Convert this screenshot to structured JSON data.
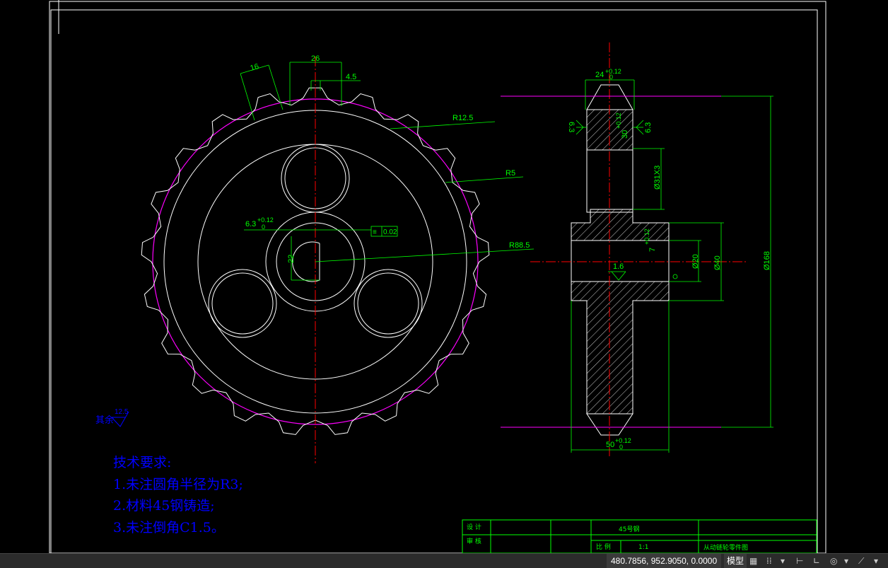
{
  "colors": {
    "background": "#000000",
    "drawing": "#ffffff",
    "dimension": "#00ff00",
    "centerline": "#ff0000",
    "pitch_circle": "#ff00ff",
    "notes": "#0000ff"
  },
  "front_view": {
    "dims": {
      "width_26": "26",
      "width_16": "16",
      "width_4_5": "4.5",
      "r12_5": "R12.5",
      "r5": "R5",
      "r88_5": "R88.5",
      "keyway": "6.3",
      "keyway_tol_upper": "+0.12",
      "keyway_tol_lower": "0",
      "bore_22": "22",
      "symmetry_tol": "0.02"
    }
  },
  "side_view": {
    "dims": {
      "width_24": "24",
      "width_24_tol_upper": "+0.12",
      "width_24_tol_lower": "0",
      "rough_63_left": "6.3",
      "rough_63_right": "6.3",
      "tooth_30": "30",
      "tooth_30_tol": "+0.12",
      "holes_31x3": "Ø31X3",
      "hub_7": "7",
      "hub_7_tol": "+0.12",
      "bore_20": "Ø20",
      "hub_40": "Ø40",
      "outer_168": "Ø168",
      "rough_16": "1.6",
      "width_50": "50",
      "width_50_tol_upper": "+0.12",
      "width_50_tol_lower": "0"
    }
  },
  "other_roughness": {
    "label": "其余",
    "value": "12.5"
  },
  "tech_requirements": {
    "title": "技术要求:",
    "items": [
      "1.未注圆角半径为R3;",
      "2.材料45钢铸造;",
      "3.未注倒角C1.5。"
    ]
  },
  "title_block": {
    "design": "设 计",
    "check": "审 核",
    "material": "45号钢",
    "scale_label": "比 例",
    "scale_value": "1:1",
    "part_name": "从动链轮零件图"
  },
  "status_bar": {
    "coordinates": "480.7856, 952.9050, 0.0000",
    "model_label": "模型",
    "grid_icon": "grid-icon",
    "snap_icon": "snap-icon",
    "ortho_icon": "ortho-icon",
    "polar_icon": "polar-icon",
    "osnap_icon": "osnap-icon"
  }
}
